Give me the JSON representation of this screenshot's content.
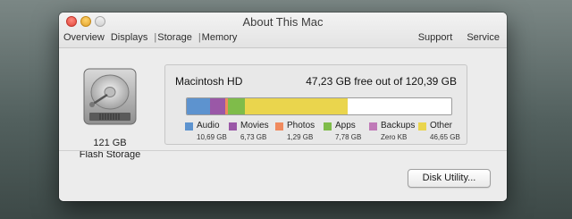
{
  "window": {
    "title": "About This Mac"
  },
  "toolbar": {
    "tabs": [
      {
        "label": "Overview"
      },
      {
        "label": "Displays"
      },
      {
        "label": "Storage"
      },
      {
        "label": "Memory"
      }
    ],
    "right_items": [
      {
        "label": "Support"
      },
      {
        "label": "Service"
      }
    ]
  },
  "drive": {
    "icon": "hard-drive-icon",
    "capacity": "121 GB",
    "type": "Flash Storage"
  },
  "volume": {
    "name": "Macintosh HD",
    "free_text": "47,23 GB free out of 120,39 GB",
    "categories": [
      {
        "label": "Audio",
        "size": "10,69 GB",
        "color": "#5d93cf",
        "fraction": 0.089
      },
      {
        "label": "Movies",
        "size": "6,73 GB",
        "color": "#9a58a7",
        "fraction": 0.056
      },
      {
        "label": "Photos",
        "size": "1,29 GB",
        "color": "#f08a5e",
        "fraction": 0.011
      },
      {
        "label": "Apps",
        "size": "7,78 GB",
        "color": "#7fbc4a",
        "fraction": 0.065
      },
      {
        "label": "Backups",
        "size": "Zero KB",
        "color": "#c07ab8",
        "fraction": 0.0
      },
      {
        "label": "Other",
        "size": "46,65 GB",
        "color": "#ead54d",
        "fraction": 0.387
      }
    ]
  },
  "buttons": {
    "disk_utility": "Disk Utility..."
  }
}
